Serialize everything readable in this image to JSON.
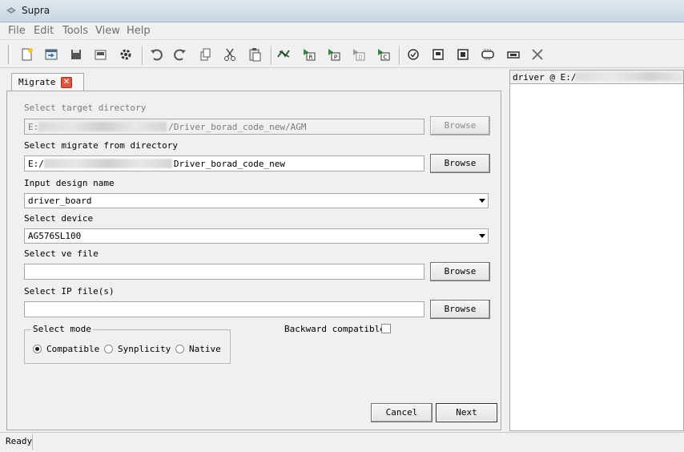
{
  "window": {
    "title": "Supra"
  },
  "menu": [
    "File",
    "Edit",
    "Tools",
    "View",
    "Help"
  ],
  "toolbar": {
    "icons": [
      "new-file-icon",
      "open-project-icon",
      "save-icon",
      "save-all-icon",
      "settings-icon",
      "undo-icon",
      "redo-icon",
      "copy-icon",
      "cut-icon",
      "paste-icon",
      "migrate-icon",
      "flow-r-icon",
      "flow-p-icon",
      "flow-d-icon",
      "flow-c-icon",
      "check-icon",
      "compile-icon",
      "chip-icon",
      "download-icon",
      "programmer-icon",
      "close-icon"
    ]
  },
  "tab": {
    "label": "Migrate",
    "close": "✕"
  },
  "form": {
    "target_dir": {
      "label": "Select target directory",
      "value_prefix": "E:",
      "value_suffix": "/Driver_borad_code_new/AGM",
      "button": "Browse"
    },
    "from_dir": {
      "label": "Select migrate from directory",
      "value_prefix": "E:/",
      "value_suffix": "Driver_borad_code_new",
      "button": "Browse"
    },
    "design_name": {
      "label": "Input design name",
      "value": "driver_board"
    },
    "device": {
      "label": "Select device",
      "value": "AG576SL100"
    },
    "ve_file": {
      "label": "Select ve file",
      "value": "",
      "button": "Browse"
    },
    "ip_file": {
      "label": "Select IP file(s)",
      "value": "",
      "button": "Browse"
    },
    "mode": {
      "legend": "Select mode",
      "options": [
        "Compatible",
        "Synplicity",
        "Native"
      ],
      "selected": "Compatible"
    },
    "backward": {
      "label": "Backward compatible",
      "checked": false
    },
    "cancel": "Cancel",
    "next": "Next"
  },
  "right_panel": {
    "header_prefix": "driver @ E:/"
  },
  "status": {
    "text": "Ready"
  }
}
